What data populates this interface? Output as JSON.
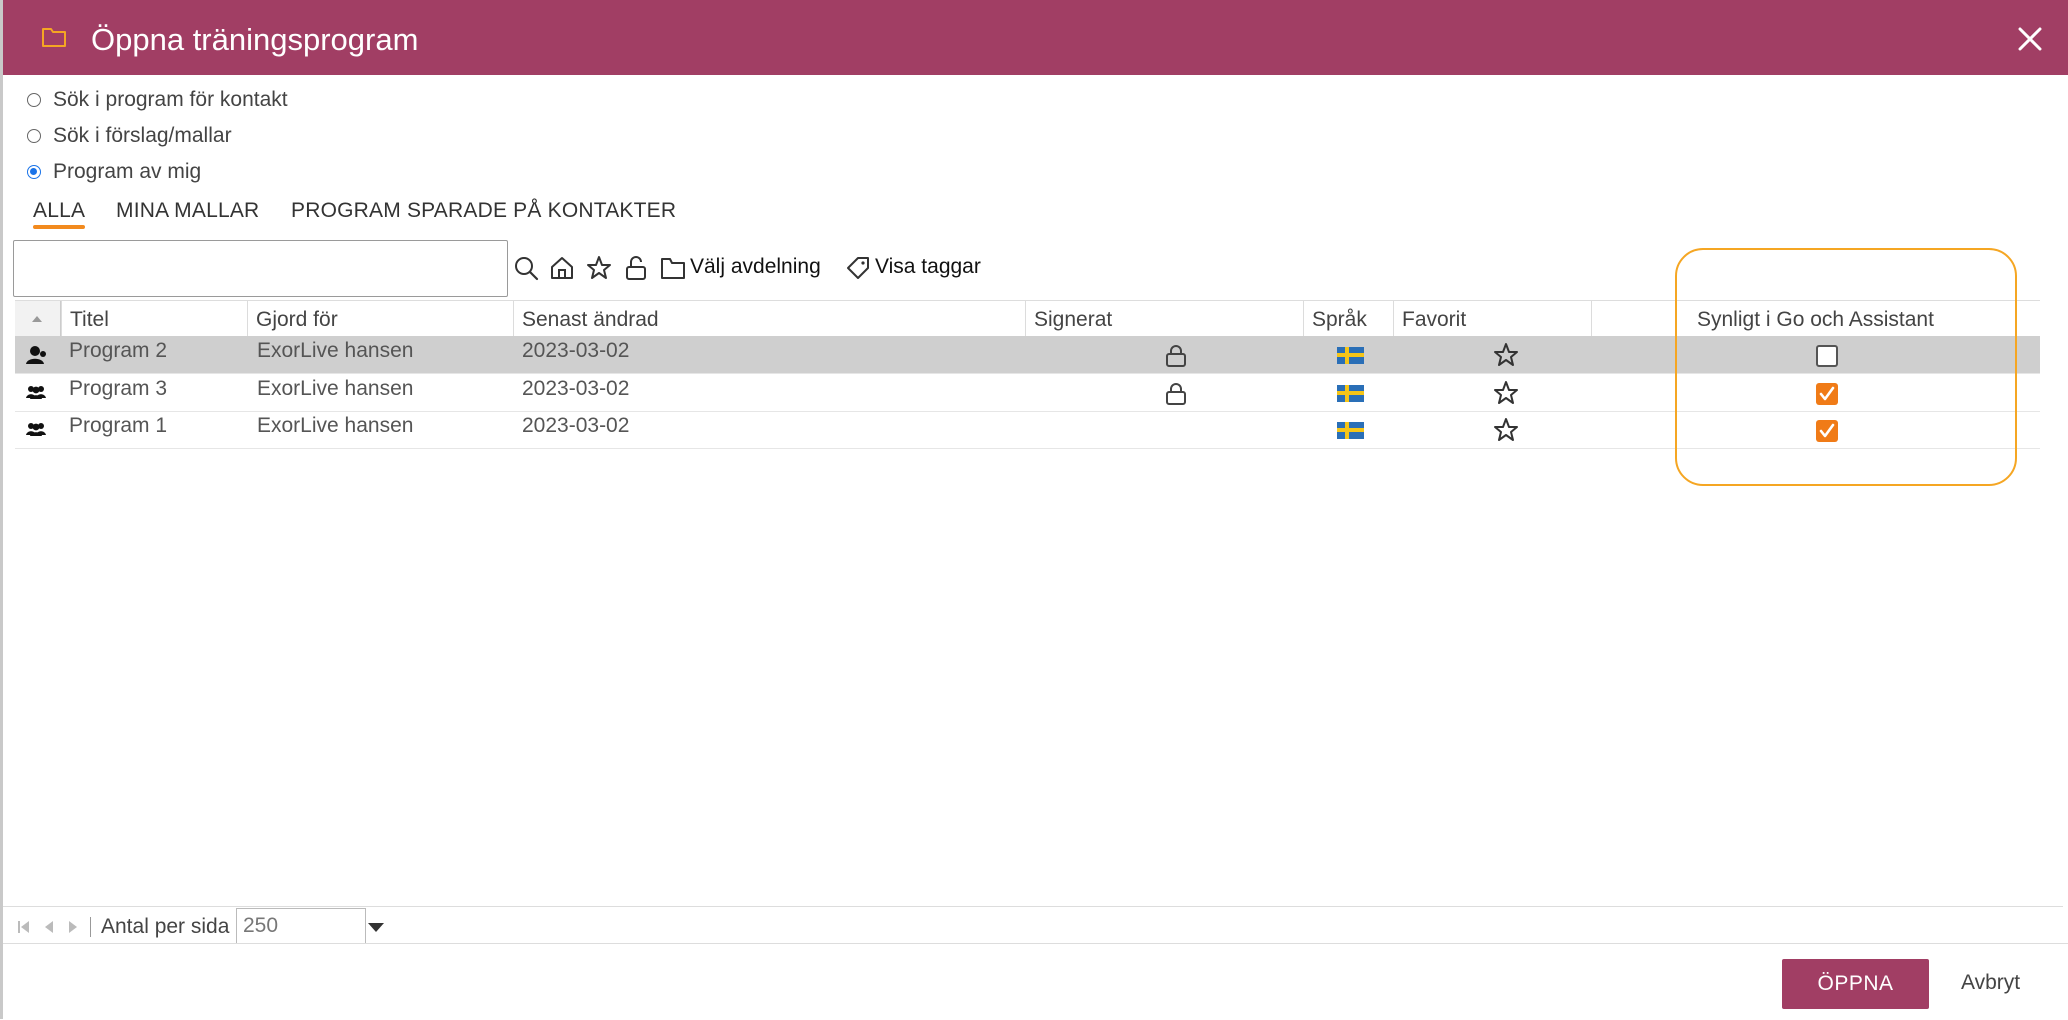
{
  "dialog": {
    "title": "Öppna träningsprogram",
    "accent": "#a13e64"
  },
  "search_modes": [
    {
      "label": "Sök i program för kontakt",
      "checked": false
    },
    {
      "label": "Sök i förslag/mallar",
      "checked": false
    },
    {
      "label": "Program av mig",
      "checked": true
    }
  ],
  "tabs": [
    {
      "label": "ALLA",
      "active": true
    },
    {
      "label": "MINA MALLAR",
      "active": false
    },
    {
      "label": "PROGRAM SPARADE PÅ KONTAKTER",
      "active": false
    }
  ],
  "toolbar": {
    "search_value": "",
    "department_label": "Välj avdelning",
    "tags_label": "Visa taggar"
  },
  "columns": {
    "title": "Titel",
    "made_for": "Gjord för",
    "modified": "Senast ändrad",
    "signed": "Signerat",
    "language": "Språk",
    "favorite": "Favorit",
    "visible": "Synligt i Go och Assistant"
  },
  "rows": [
    {
      "title": "Program 2",
      "made_for": "ExorLive hansen",
      "modified": "2023-03-02",
      "signed": true,
      "language_icon": "sweden-flag-icon",
      "visible": false,
      "selected": true,
      "type_icon": "single-user-icon"
    },
    {
      "title": "Program 3",
      "made_for": "ExorLive hansen",
      "modified": "2023-03-02",
      "signed": true,
      "language_icon": "sweden-flag-icon",
      "visible": true,
      "selected": false,
      "type_icon": "group-icon"
    },
    {
      "title": "Program 1",
      "made_for": "ExorLive hansen",
      "modified": "2023-03-02",
      "signed": false,
      "language_icon": "sweden-flag-icon",
      "visible": true,
      "selected": false,
      "type_icon": "group-icon"
    }
  ],
  "pager": {
    "label": "Antal per sida",
    "per_page": "250"
  },
  "footer": {
    "open_label": "ÖPPNA",
    "cancel_label": "Avbryt"
  },
  "colors": {
    "checkbox_on": "#f07b17",
    "tab_underline": "#f28a1e",
    "highlight": "#f5a623"
  }
}
